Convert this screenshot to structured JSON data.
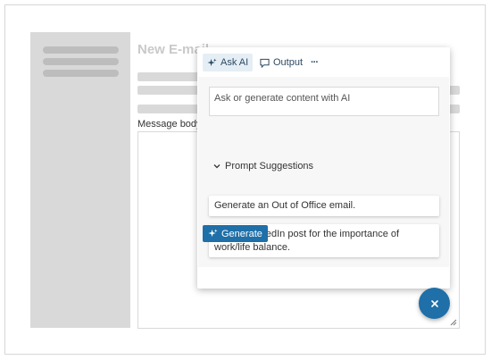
{
  "email": {
    "title": "New E-mail",
    "message_label": "Message body"
  },
  "ai_assist": {
    "toolbar": {
      "ask_ai_label": "Ask AI",
      "output_label": "Output",
      "more_label": "···"
    },
    "prompt_placeholder": "Ask or generate content with AI",
    "suggestions_header": "Prompt Suggestions",
    "suggestions": [
      "Generate an Out of Office email.",
      "Write a LinkedIn post for the importance of work/life balance."
    ],
    "generate_label": "Generate"
  },
  "fab": {
    "icon": "close-icon",
    "label": "×"
  },
  "colors": {
    "accent": "#1f6fa8",
    "placeholder_block": "#d9d9d9",
    "skeleton_line": "#bdbdbd"
  }
}
